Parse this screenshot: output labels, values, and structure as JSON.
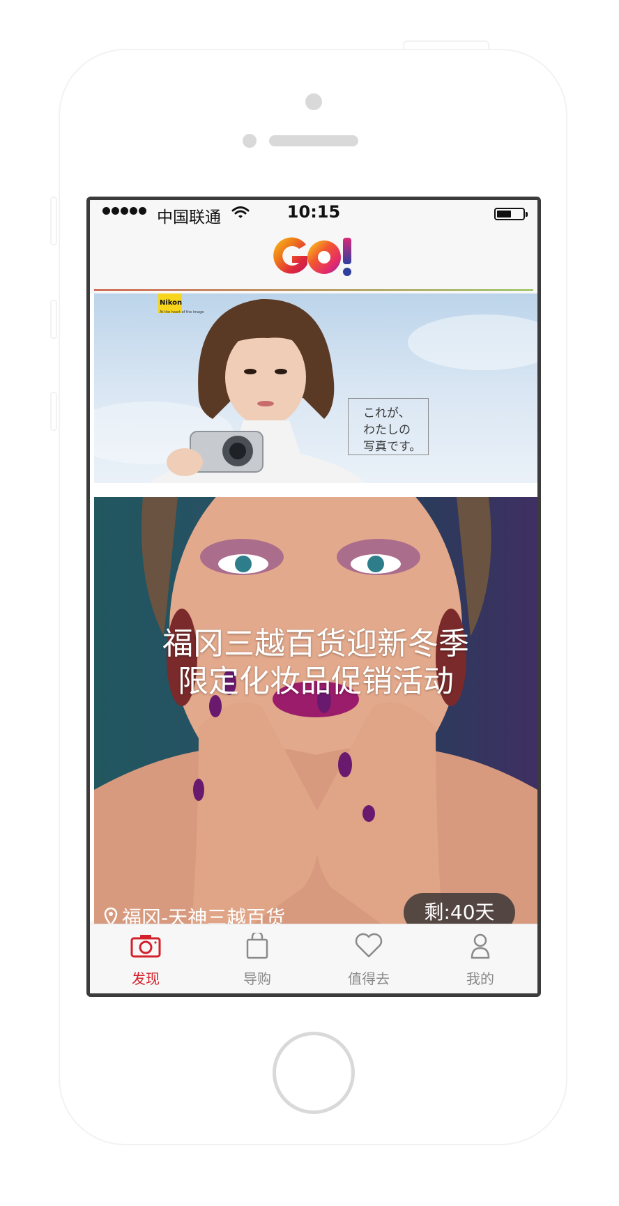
{
  "status_bar": {
    "carrier": "中国联通",
    "time": "10:15"
  },
  "header": {
    "logo_text": "GO!"
  },
  "feed": {
    "banner1": {
      "camera_brand": "Nikon",
      "brand_tagline": "At the heart of the image",
      "caption_lines": [
        "これが、",
        "わたしの",
        "写真です。"
      ]
    },
    "banner2": {
      "title_line1": "福冈三越百货迎新冬季",
      "title_line2": "限定化妆品促销活动",
      "location": "福冈-天神三越百货",
      "remaining": "剩:40天"
    }
  },
  "tabbar": {
    "tabs": [
      {
        "label": "发现",
        "icon": "camera-icon",
        "active": true
      },
      {
        "label": "导购",
        "icon": "shopping-bag-icon",
        "active": false
      },
      {
        "label": "值得去",
        "icon": "heart-icon",
        "active": false
      },
      {
        "label": "我的",
        "icon": "person-icon",
        "active": false
      }
    ]
  },
  "colors": {
    "accent": "#d4202a",
    "inactive": "#8a8a8a",
    "bezel": "#3b3b3b"
  }
}
